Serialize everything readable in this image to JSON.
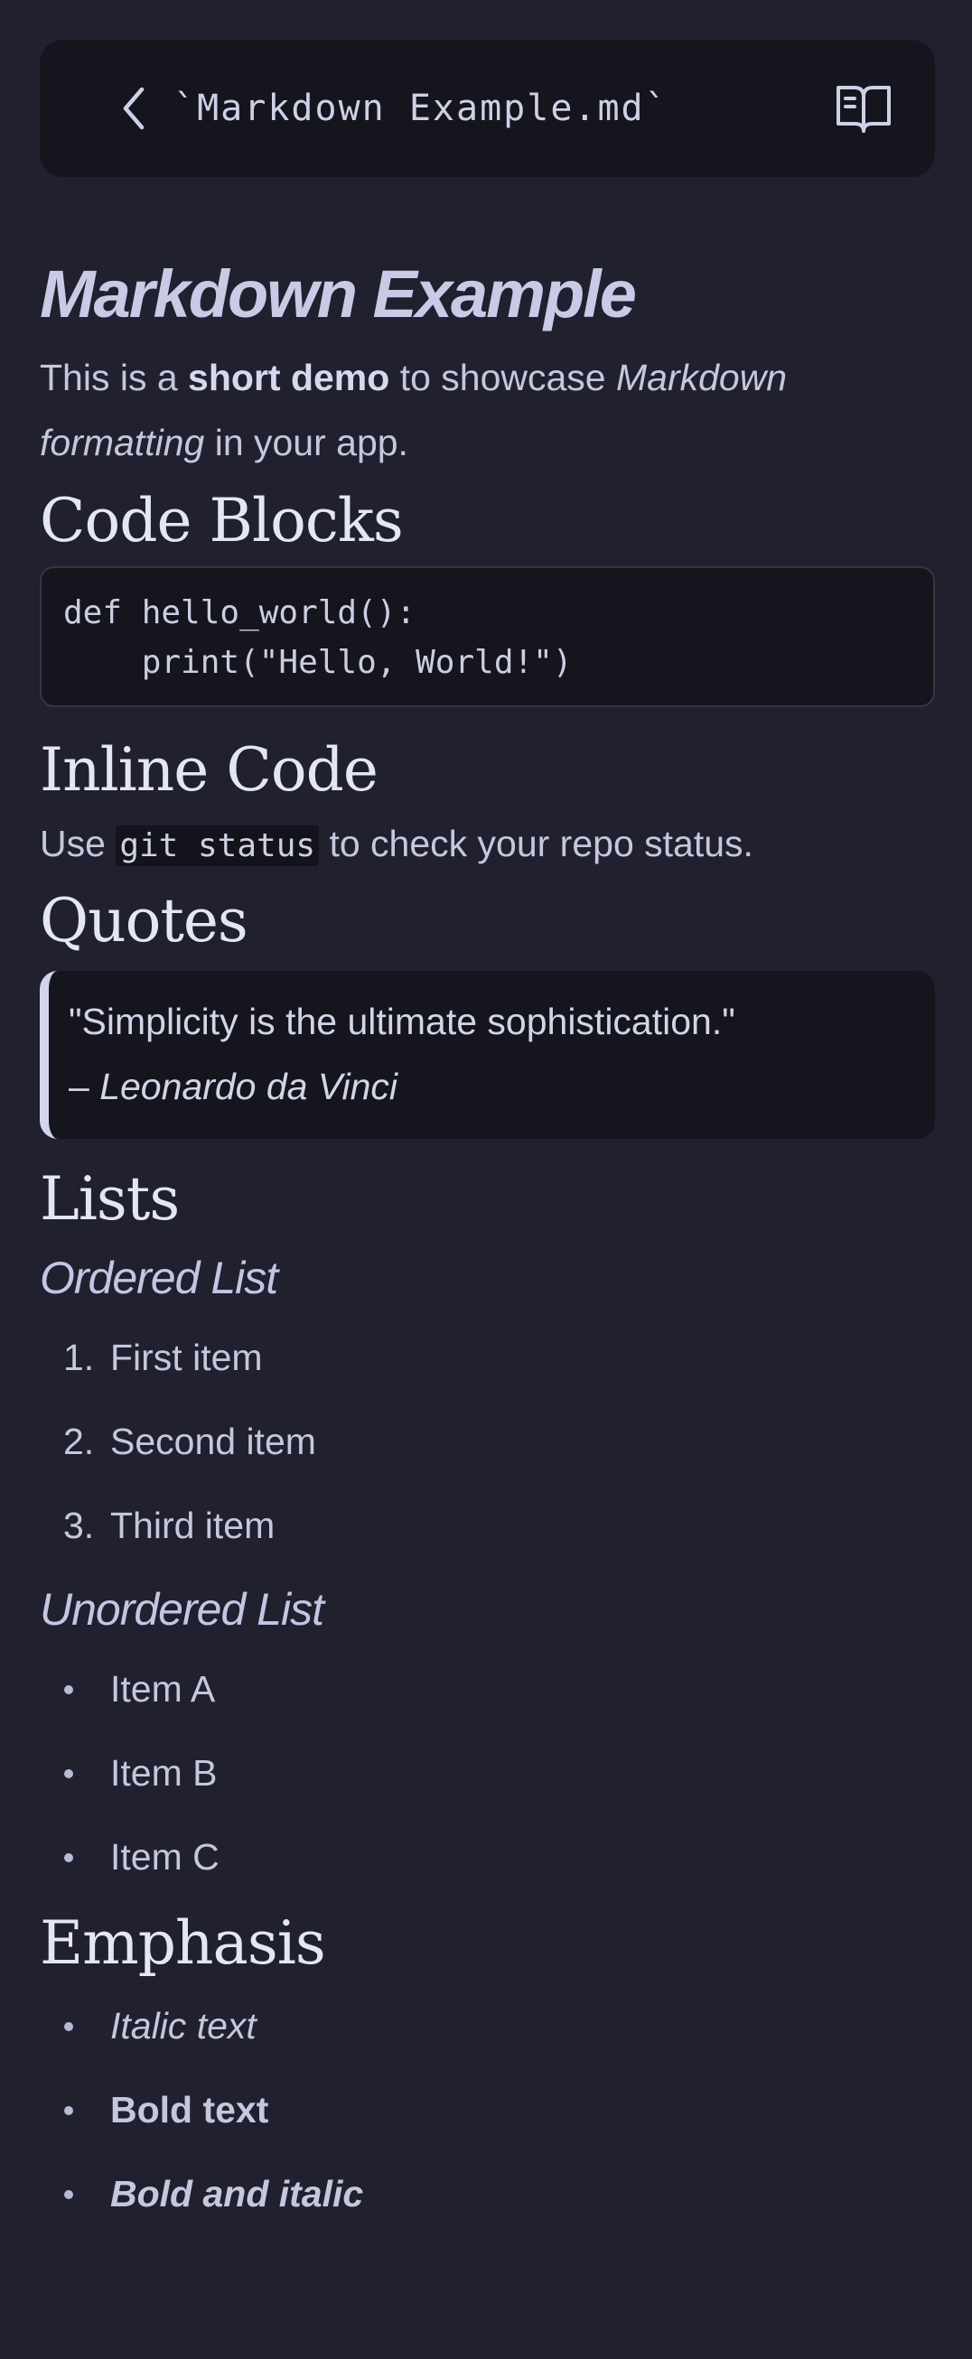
{
  "header": {
    "title": "`Markdown Example.md`",
    "back_icon": "chevron-left-icon",
    "reader_icon": "book-open-icon"
  },
  "document": {
    "title": "Markdown Example",
    "intro": {
      "part1": "This is a ",
      "bold": "short demo",
      "part2": " to showcase ",
      "italic1": "Markdown",
      "italic2": "formatting",
      "part3": " in your app."
    },
    "sections": {
      "code_blocks": {
        "heading": "Code Blocks",
        "code": "def hello_world():\n    print(\"Hello, World!\")"
      },
      "inline_code": {
        "heading": "Inline Code",
        "before": "Use ",
        "code": "git status",
        "after": " to check your repo status."
      },
      "quotes": {
        "heading": "Quotes",
        "quote": "\"Simplicity is the ultimate sophistication.\"",
        "dash": "– ",
        "author": "Leonardo da Vinci"
      },
      "lists": {
        "heading": "Lists",
        "ordered_heading": "Ordered List",
        "ordered": [
          "First item",
          "Second item",
          "Third item"
        ],
        "unordered_heading": "Unordered List",
        "unordered": [
          "Item A",
          "Item B",
          "Item C"
        ]
      },
      "emphasis": {
        "heading": "Emphasis",
        "italic": "Italic text",
        "bold": "Bold text",
        "bold_italic": "Bold and italic"
      }
    }
  },
  "colors": {
    "background": "#20202e",
    "surface": "#15151e",
    "text": "#c6c7de",
    "heading": "#e4e5f5",
    "accent": "#d3d4ee"
  }
}
